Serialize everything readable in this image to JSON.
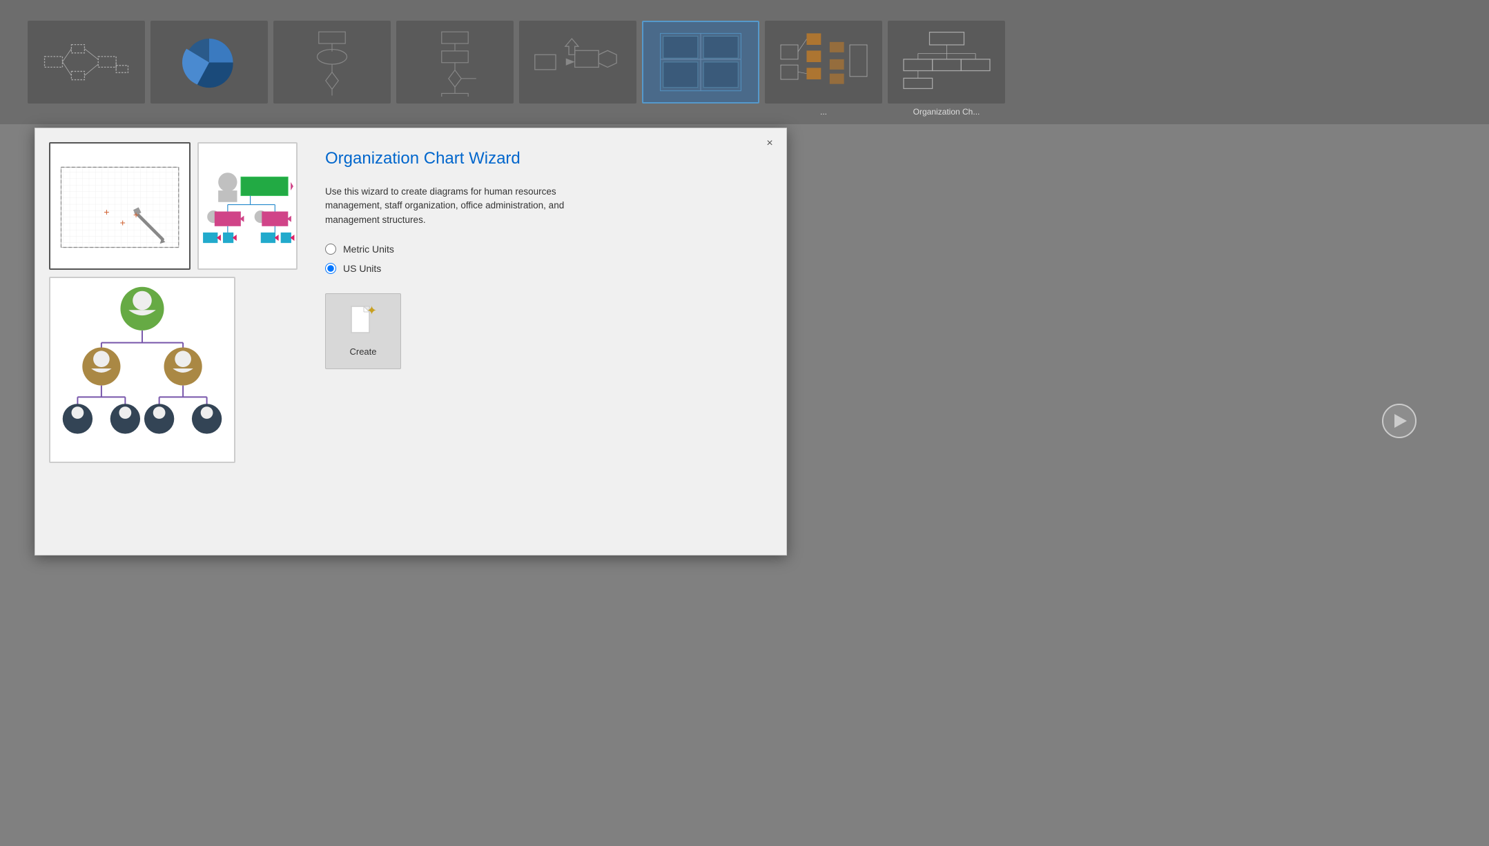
{
  "background": {
    "strip_height": 180,
    "thumbs": [
      {
        "id": "t1",
        "label": ""
      },
      {
        "id": "t2",
        "label": ""
      },
      {
        "id": "t3",
        "label": ""
      },
      {
        "id": "t4",
        "label": ""
      },
      {
        "id": "t5",
        "label": ""
      },
      {
        "id": "t6",
        "label": "",
        "selected": true
      },
      {
        "id": "t7",
        "label": ""
      },
      {
        "id": "t8",
        "label": ""
      }
    ]
  },
  "bg_labels": {
    "label7": "...",
    "label8": "Organization Ch..."
  },
  "dialog": {
    "title": "Organization Chart Wizard",
    "description": "Use this wizard to create diagrams for human resources management, staff organization, office administration, and management structures.",
    "close_label": "×",
    "units": {
      "metric_label": "Metric Units",
      "us_label": "US Units",
      "selected": "us"
    },
    "create_button_label": "Create"
  }
}
